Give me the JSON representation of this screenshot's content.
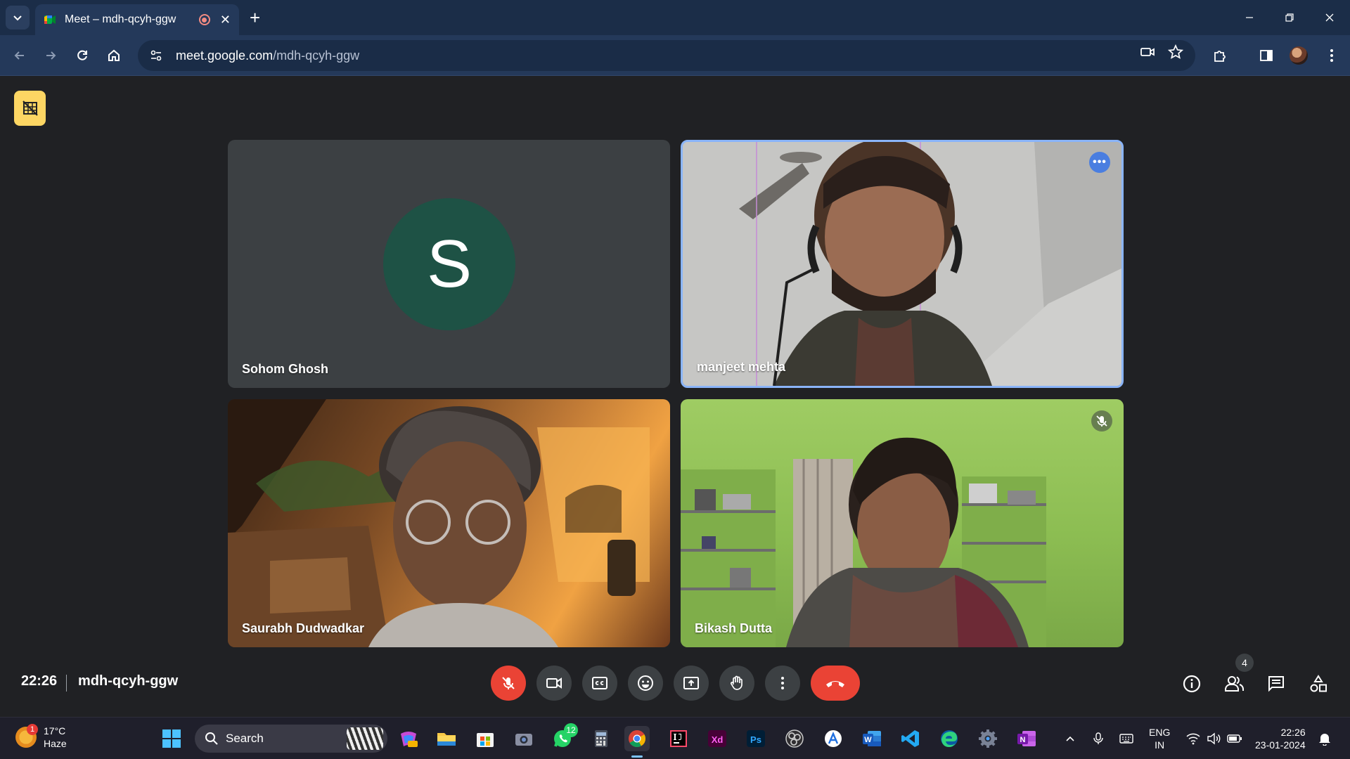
{
  "browser": {
    "tab_title": "Meet – mdh-qcyh-ggw",
    "new_tab_label": "+",
    "url_host": "meet.google.com",
    "url_path": "/mdh-qcyh-ggw"
  },
  "meeting": {
    "time": "22:26",
    "code": "mdh-qcyh-ggw",
    "participant_count": "4",
    "avatar_letter": "S",
    "participants": [
      {
        "name": "Sohom Ghosh"
      },
      {
        "name": "manjeet mehta"
      },
      {
        "name": "Saurabh Dudwadkar"
      },
      {
        "name": "Bikash Dutta"
      }
    ],
    "more_options_label": "•••"
  },
  "taskbar": {
    "weather_badge": "1",
    "weather_temp": "17°C",
    "weather_desc": "Haze",
    "search_label": "Search",
    "whatsapp_badge": "12",
    "lang_top": "ENG",
    "lang_bottom": "IN",
    "clock_time": "22:26",
    "clock_date": "23-01-2024"
  },
  "colors": {
    "accent": "#8ab4f8",
    "danger": "#ea4335",
    "background": "#202124",
    "tab_bar": "#1b2d48"
  }
}
